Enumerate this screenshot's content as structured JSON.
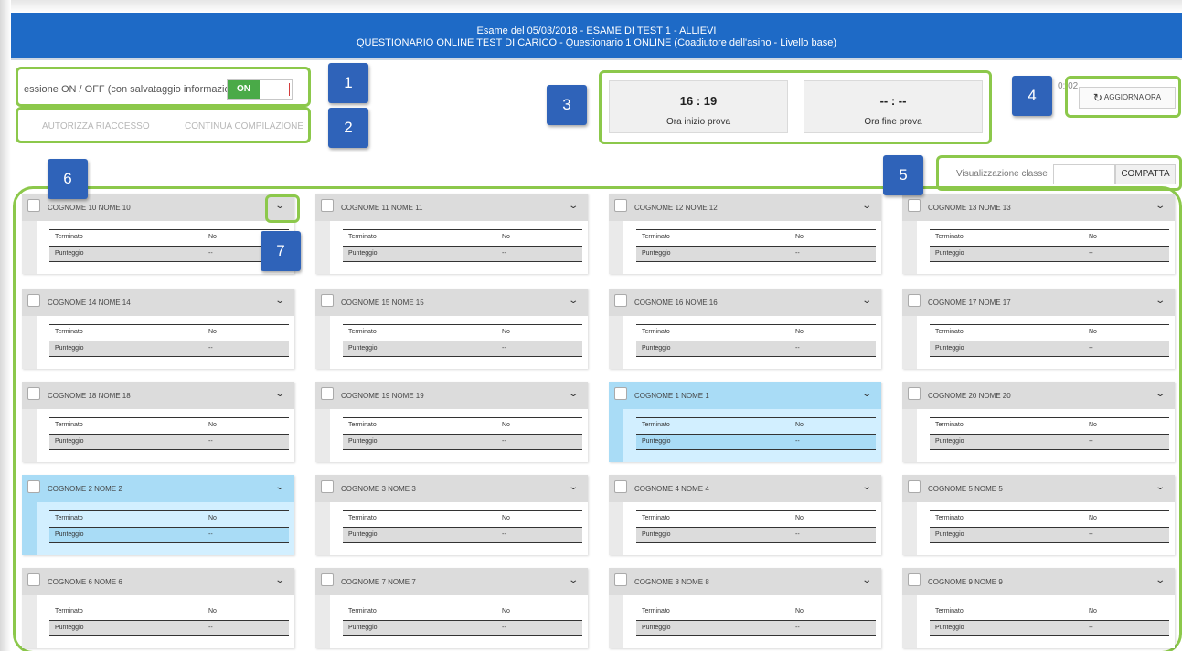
{
  "header": {
    "line1": "Esame del 05/03/2018 - ESAME DI TEST 1 - ALLIEVI",
    "line2": "QUESTIONARIO ONLINE TEST DI CARICO - Questionario 1 ONLINE (Coadiutore dell'asino - Livello base)"
  },
  "session": {
    "label": "essione ON / OFF (con salvataggio informazioni)",
    "toggle_label": "ON"
  },
  "actions": {
    "authorize": "AUTORIZZA RIACCESSO",
    "continue": "CONTINUA COMPILAZIONE"
  },
  "times": {
    "start_value": "16 : 19",
    "start_label": "Ora inizio prova",
    "end_value": "-- : --",
    "end_label": "Ora fine prova"
  },
  "refresh": {
    "partial_time": "0: 02",
    "button_label": "AGGIORNA ORA"
  },
  "view": {
    "label": "Visualizzazione classe",
    "button_label": "COMPATTA"
  },
  "callouts": [
    "1",
    "2",
    "3",
    "4",
    "5",
    "6",
    "7"
  ],
  "student_fields": {
    "finished_label": "Terminato",
    "score_label": "Punteggio"
  },
  "students": [
    {
      "name": "COGNOME 10 NOME 10",
      "finished": "No",
      "score": "--",
      "selected": false
    },
    {
      "name": "COGNOME 11 NOME 11",
      "finished": "No",
      "score": "--",
      "selected": false
    },
    {
      "name": "COGNOME 12 NOME 12",
      "finished": "No",
      "score": "--",
      "selected": false
    },
    {
      "name": "COGNOME 13 NOME 13",
      "finished": "No",
      "score": "--",
      "selected": false
    },
    {
      "name": "COGNOME 14 NOME 14",
      "finished": "No",
      "score": "--",
      "selected": false
    },
    {
      "name": "COGNOME 15 NOME 15",
      "finished": "No",
      "score": "--",
      "selected": false
    },
    {
      "name": "COGNOME 16 NOME 16",
      "finished": "No",
      "score": "--",
      "selected": false
    },
    {
      "name": "COGNOME 17 NOME 17",
      "finished": "No",
      "score": "--",
      "selected": false
    },
    {
      "name": "COGNOME 18 NOME 18",
      "finished": "No",
      "score": "--",
      "selected": false
    },
    {
      "name": "COGNOME 19 NOME 19",
      "finished": "No",
      "score": "--",
      "selected": false
    },
    {
      "name": "COGNOME 1 NOME 1",
      "finished": "No",
      "score": "--",
      "selected": true
    },
    {
      "name": "COGNOME 20 NOME 20",
      "finished": "No",
      "score": "--",
      "selected": false
    },
    {
      "name": "COGNOME 2 NOME 2",
      "finished": "No",
      "score": "--",
      "selected": true
    },
    {
      "name": "COGNOME 3 NOME 3",
      "finished": "No",
      "score": "--",
      "selected": false
    },
    {
      "name": "COGNOME 4 NOME 4",
      "finished": "No",
      "score": "--",
      "selected": false
    },
    {
      "name": "COGNOME 5 NOME 5",
      "finished": "No",
      "score": "--",
      "selected": false
    },
    {
      "name": "COGNOME 6 NOME 6",
      "finished": "No",
      "score": "--",
      "selected": false
    },
    {
      "name": "COGNOME 7 NOME 7",
      "finished": "No",
      "score": "--",
      "selected": false
    },
    {
      "name": "COGNOME 8 NOME 8",
      "finished": "No",
      "score": "--",
      "selected": false
    },
    {
      "name": "COGNOME 9 NOME 9",
      "finished": "No",
      "score": "--",
      "selected": false
    }
  ]
}
